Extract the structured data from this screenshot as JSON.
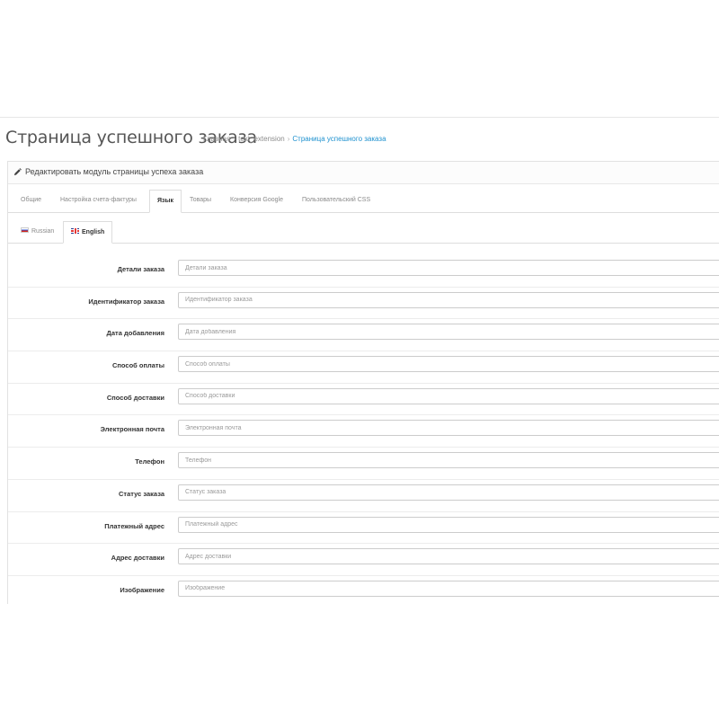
{
  "header": {
    "title": "Страница успешного заказа",
    "breadcrumb": [
      "Главная",
      "text_extension",
      "Страница успешного заказа"
    ]
  },
  "panel": {
    "title": "Редактировать модуль страницы успеха заказа",
    "icon": "pencil-icon"
  },
  "tabs": [
    {
      "label": "Общие",
      "active": false
    },
    {
      "label": "Настройка счета-фактуры",
      "active": false
    },
    {
      "label": "Язык",
      "active": true
    },
    {
      "label": "Товары",
      "active": false
    },
    {
      "label": "Конверсия Google",
      "active": false
    },
    {
      "label": "Пользовательский CSS",
      "active": false
    }
  ],
  "language_tabs": [
    {
      "label": "Russian",
      "flag": "ru-flag-icon",
      "active": false
    },
    {
      "label": "English",
      "flag": "gb-flag-icon",
      "active": true
    }
  ],
  "fields": [
    {
      "label": "Детали заказа",
      "placeholder": "Детали заказа",
      "value": ""
    },
    {
      "label": "Идентификатор заказа",
      "placeholder": "Идентификатор заказа",
      "value": ""
    },
    {
      "label": "Дата добавления",
      "placeholder": "Дата добавления",
      "value": ""
    },
    {
      "label": "Способ оплаты",
      "placeholder": "Способ оплаты",
      "value": ""
    },
    {
      "label": "Способ доставки",
      "placeholder": "Способ доставки",
      "value": ""
    },
    {
      "label": "Электронная почта",
      "placeholder": "Электронная почта",
      "value": ""
    },
    {
      "label": "Телефон",
      "placeholder": "Телефон",
      "value": ""
    },
    {
      "label": "Статус заказа",
      "placeholder": "Статус заказа",
      "value": ""
    },
    {
      "label": "Платежный адрес",
      "placeholder": "Платежный адрес",
      "value": ""
    },
    {
      "label": "Адрес доставки",
      "placeholder": "Адрес доставки",
      "value": ""
    },
    {
      "label": "Изображение",
      "placeholder": "Изображение",
      "value": ""
    }
  ],
  "colors": {
    "link": "#1e91cf",
    "text": "#555555",
    "border": "#dddddd"
  }
}
